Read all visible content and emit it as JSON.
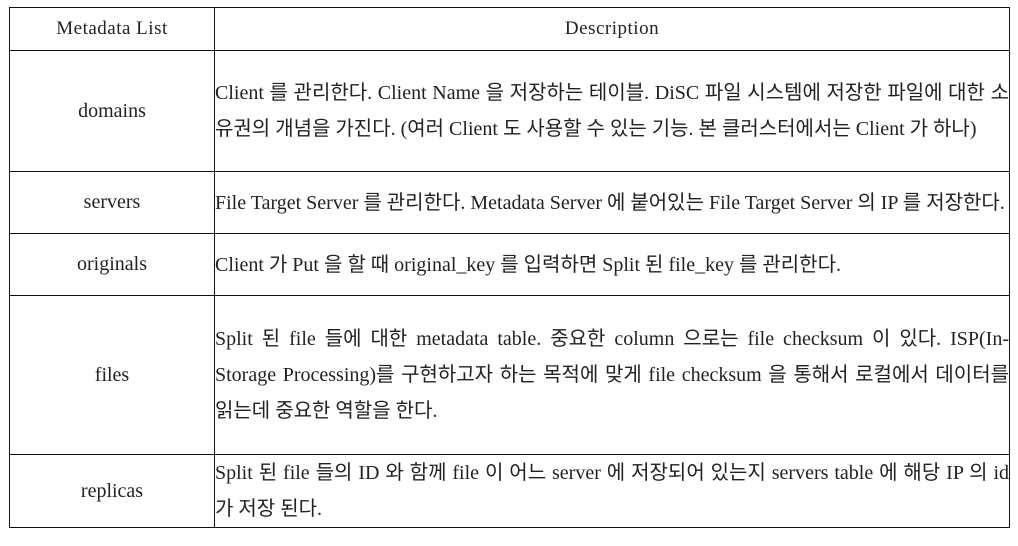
{
  "table": {
    "headers": {
      "name": "Metadata List",
      "description": "Description"
    },
    "rows": [
      {
        "name": "domains",
        "description": "Client 를 관리한다.   Client Name 을 저장하는 테이블. DiSC 파일 시스템에 저장한 파일에 대한   소유권의 개념을 가진다. (여러 Client 도 사용할   수 있는 기능. 본 클러스터에서는 Client 가 하나)"
      },
      {
        "name": "servers",
        "description": "File Target Server 를 관리한다. Metadata Server 에 붙어있는 File Target   Server 의 IP 를 저장한다."
      },
      {
        "name": "originals",
        "description": "Client 가 Put 을   할 때 original_key 를 입력하면 Split 된 file_key 를 관리한다."
      },
      {
        "name": "files",
        "description": "Split 된 file 들에   대한 metadata table. 중요한 column 으로는 file checksum 이 있다. ISP(In-Storage Processing)를 구현하고자 하는 목적에 맞게 file checksum 을 통해서 로컬에서 데이터를 읽는데 중요한 역할을 한다."
      },
      {
        "name": "replicas",
        "description": "Split 된 file 들의 ID 와 함께 file 이 어느   server 에 저장되어 있는지 servers table 에 해당 IP 의 id 가 저장 된다."
      }
    ]
  }
}
